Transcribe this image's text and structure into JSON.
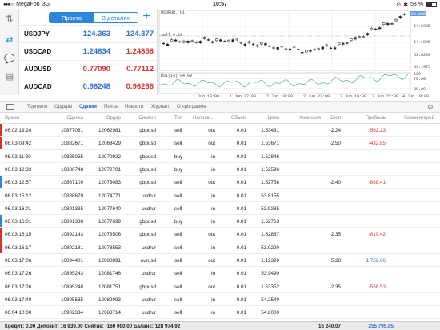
{
  "status": {
    "carrier": "MegaFon",
    "network": "3G",
    "time": "10:57",
    "battery": "58 %"
  },
  "quotes": {
    "view_simple": "Просто",
    "view_details": "В деталях",
    "rows": [
      {
        "symbol": "USDJPY",
        "bid": "124.363",
        "ask": "124.377",
        "dir": "up"
      },
      {
        "symbol": "USDCAD",
        "bid": "1.24834",
        "ask": "1.24856",
        "dir": "down"
      },
      {
        "symbol": "AUDUSD",
        "bid": "0.77090",
        "ask": "0.77112",
        "dir": "down"
      },
      {
        "symbol": "AUDCAD",
        "bid": "0.96248",
        "ask": "0.96266",
        "dir": "down"
      }
    ]
  },
  "chart": {
    "symbol_tf": "USDRUR, H1",
    "sell_label": "sell 0.10",
    "rsi_label": "RSI(14) 84.80",
    "prices": [
      "54.6335",
      "54.1045",
      "53.6230",
      "53.1475"
    ],
    "price_current": "54.8955",
    "rsi_levels": [
      "100",
      "70.00",
      "30.00"
    ],
    "times": [
      "1 Jun 10:00",
      "1 Jun 22:00",
      "2 Jun 10:00",
      "2 Jun 22:00",
      "3 Jun 10:00",
      "3 Jun 22:00",
      "4 Jun 10:00"
    ]
  },
  "tabs": [
    "Торговля",
    "Ордеры",
    "Сделки",
    "Почта",
    "Новости",
    "Журнал",
    "О программе"
  ],
  "active_tab": "Сделки",
  "table": {
    "headers": {
      "time": "Время",
      "deal": "Сделка",
      "order": "Ордер",
      "symbol": "Символ",
      "type": "Тип",
      "direction": "Направ...",
      "volume": "Объем",
      "price": "Цена",
      "commission": "Комиссия",
      "swap": "Своп",
      "profit": "Прибыль",
      "comment": "Комментарий"
    },
    "rows": [
      {
        "time": "06.02 19:24",
        "deal": "10877081",
        "order": "12062981",
        "symbol": "gbpusd",
        "type": "sell",
        "dir": "out",
        "vol": "0.01",
        "price": "1.53431",
        "comm": "",
        "swap": "-2.24",
        "profit": "-562.23",
        "pclass": "neg",
        "marker": "#d9302c"
      },
      {
        "time": "06.03 09:42",
        "deal": "10882671",
        "order": "12068429",
        "symbol": "gbpusd",
        "type": "sell",
        "dir": "out",
        "vol": "0.01",
        "price": "1.53671",
        "comm": "",
        "swap": "-2.50",
        "profit": "-432.85",
        "pclass": "neg",
        "marker": "#d9302c"
      },
      {
        "time": "06.03 11:30",
        "deal": "10885055",
        "order": "12070922",
        "symbol": "gbpusd",
        "type": "buy",
        "dir": "in",
        "vol": "0.01",
        "price": "1.52846",
        "comm": "",
        "swap": "",
        "profit": "",
        "pclass": "",
        "marker": ""
      },
      {
        "time": "06.03 12:33",
        "deal": "10886748",
        "order": "12072701",
        "symbol": "gbpusd",
        "type": "buy",
        "dir": "in",
        "vol": "0.01",
        "price": "1.52596",
        "comm": "",
        "swap": "",
        "profit": "",
        "pclass": "",
        "marker": ""
      },
      {
        "time": "06.03 12:57",
        "deal": "10887109",
        "order": "12073083",
        "symbol": "gbpusd",
        "type": "sell",
        "dir": "out",
        "vol": "0.01",
        "price": "1.52758",
        "comm": "",
        "swap": "-2.40",
        "profit": "-888.41",
        "pclass": "neg",
        "marker": "#2c86d9"
      },
      {
        "time": "06.03 15:12",
        "deal": "10888679",
        "order": "12074771",
        "symbol": "usdrur",
        "type": "sell",
        "dir": "in",
        "vol": "0.01",
        "price": "53.6155",
        "comm": "",
        "swap": "",
        "profit": "",
        "pclass": "",
        "marker": ""
      },
      {
        "time": "06.03 16:01",
        "deal": "10891335",
        "order": "12077640",
        "symbol": "usdrur",
        "type": "sell",
        "dir": "in",
        "vol": "0.01",
        "price": "53.9285",
        "comm": "",
        "swap": "",
        "profit": "",
        "pclass": "",
        "marker": ""
      },
      {
        "time": "06.03 16:01",
        "deal": "10891388",
        "order": "12077699",
        "symbol": "gbpusd",
        "type": "buy",
        "dir": "in",
        "vol": "0.01",
        "price": "1.52763",
        "comm": "",
        "swap": "",
        "profit": "",
        "pclass": "",
        "marker": "#2c86d9"
      },
      {
        "time": "06.03 16:15",
        "deal": "10892143",
        "order": "12078506",
        "symbol": "gbpusd",
        "type": "sell",
        "dir": "out",
        "vol": "0.01",
        "price": "1.52867",
        "comm": "",
        "swap": "-2.35",
        "profit": "-819.42",
        "pclass": "neg",
        "marker": "#d9302c"
      },
      {
        "time": "06.03 16:17",
        "deal": "10892181",
        "order": "12078553",
        "symbol": "usdrur",
        "type": "sell",
        "dir": "in",
        "vol": "0.01",
        "price": "53.9220",
        "comm": "",
        "swap": "",
        "profit": "",
        "pclass": "",
        "marker": "#d9302c"
      },
      {
        "time": "06.03 17:06",
        "deal": "10894401",
        "order": "12080891",
        "symbol": "eurusd",
        "type": "sell",
        "dir": "out",
        "vol": "0.01",
        "price": "1.12320",
        "comm": "",
        "swap": "-5.28",
        "profit": "1 752.66",
        "pclass": "pos",
        "marker": ""
      },
      {
        "time": "06.03 17:26",
        "deal": "10895243",
        "order": "12081746",
        "symbol": "usdrur",
        "type": "sell",
        "dir": "in",
        "vol": "0.01",
        "price": "53.9490",
        "comm": "",
        "swap": "",
        "profit": "",
        "pclass": "",
        "marker": ""
      },
      {
        "time": "06.03 17:26",
        "deal": "10895248",
        "order": "12081751",
        "symbol": "gbpusd",
        "type": "sell",
        "dir": "out",
        "vol": "0.01",
        "price": "1.53352",
        "comm": "",
        "swap": "-2.35",
        "profit": "-558.53",
        "pclass": "neg",
        "marker": ""
      },
      {
        "time": "06.03 17:40",
        "deal": "10895585",
        "order": "12082093",
        "symbol": "usdrur",
        "type": "sell",
        "dir": "in",
        "vol": "0.01",
        "price": "54.2540",
        "comm": "",
        "swap": "",
        "profit": "",
        "pclass": "",
        "marker": ""
      },
      {
        "time": "06.04 10:00",
        "deal": "10902334",
        "order": "12088714",
        "symbol": "usdrur",
        "type": "sell",
        "dir": "in",
        "vol": "0.01",
        "price": "54.8000",
        "comm": "",
        "swap": "",
        "profit": "",
        "pclass": "",
        "marker": ""
      }
    ]
  },
  "footer": {
    "summary": "Кредит: 0.00 Депозит: 16 939.00 Снятие: -160 000.00 Баланс: 128 974.92",
    "swap_total": "16 240.07",
    "profit_total": "255 795.85"
  },
  "colors": {
    "accent": "#2c86d9",
    "up": "#2c6fd1",
    "down": "#d9302c"
  }
}
